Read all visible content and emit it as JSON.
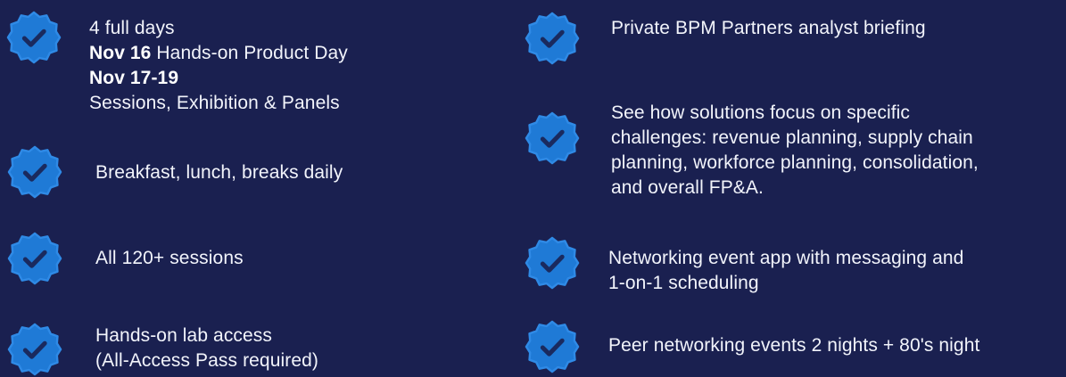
{
  "colors": {
    "background": "#1a2050",
    "badge": "#1f7ad6",
    "badge_highlight": "#2f8ae6",
    "check": "#1a2a5e",
    "text": "#f2f4fb"
  },
  "icon": "checkmark-badge-icon",
  "left_column": {
    "days": {
      "line1": "4 full days",
      "product_day_date": "Nov 16",
      "product_day_label": " Hands-on Product Day",
      "sessions_date": "Nov 17-19",
      "sessions_label": "Sessions, Exhibition & Panels"
    },
    "meals": "Breakfast, lunch, breaks daily",
    "sessions": "All 120+ sessions",
    "lab": {
      "line1": "Hands-on lab access",
      "line2": "(All-Access Pass required)"
    }
  },
  "right_column": {
    "briefing": "Private BPM Partners analyst briefing",
    "solutions": {
      "line1": "See how solutions focus on specific",
      "line2": "challenges: revenue planning, supply chain",
      "line3": "planning, workforce planning, consolidation,",
      "line4": "and overall FP&A."
    },
    "app": {
      "line1": "Networking event app with messaging and",
      "line2": "1-on-1 scheduling"
    },
    "peer": "Peer networking events 2 nights + 80's night"
  }
}
